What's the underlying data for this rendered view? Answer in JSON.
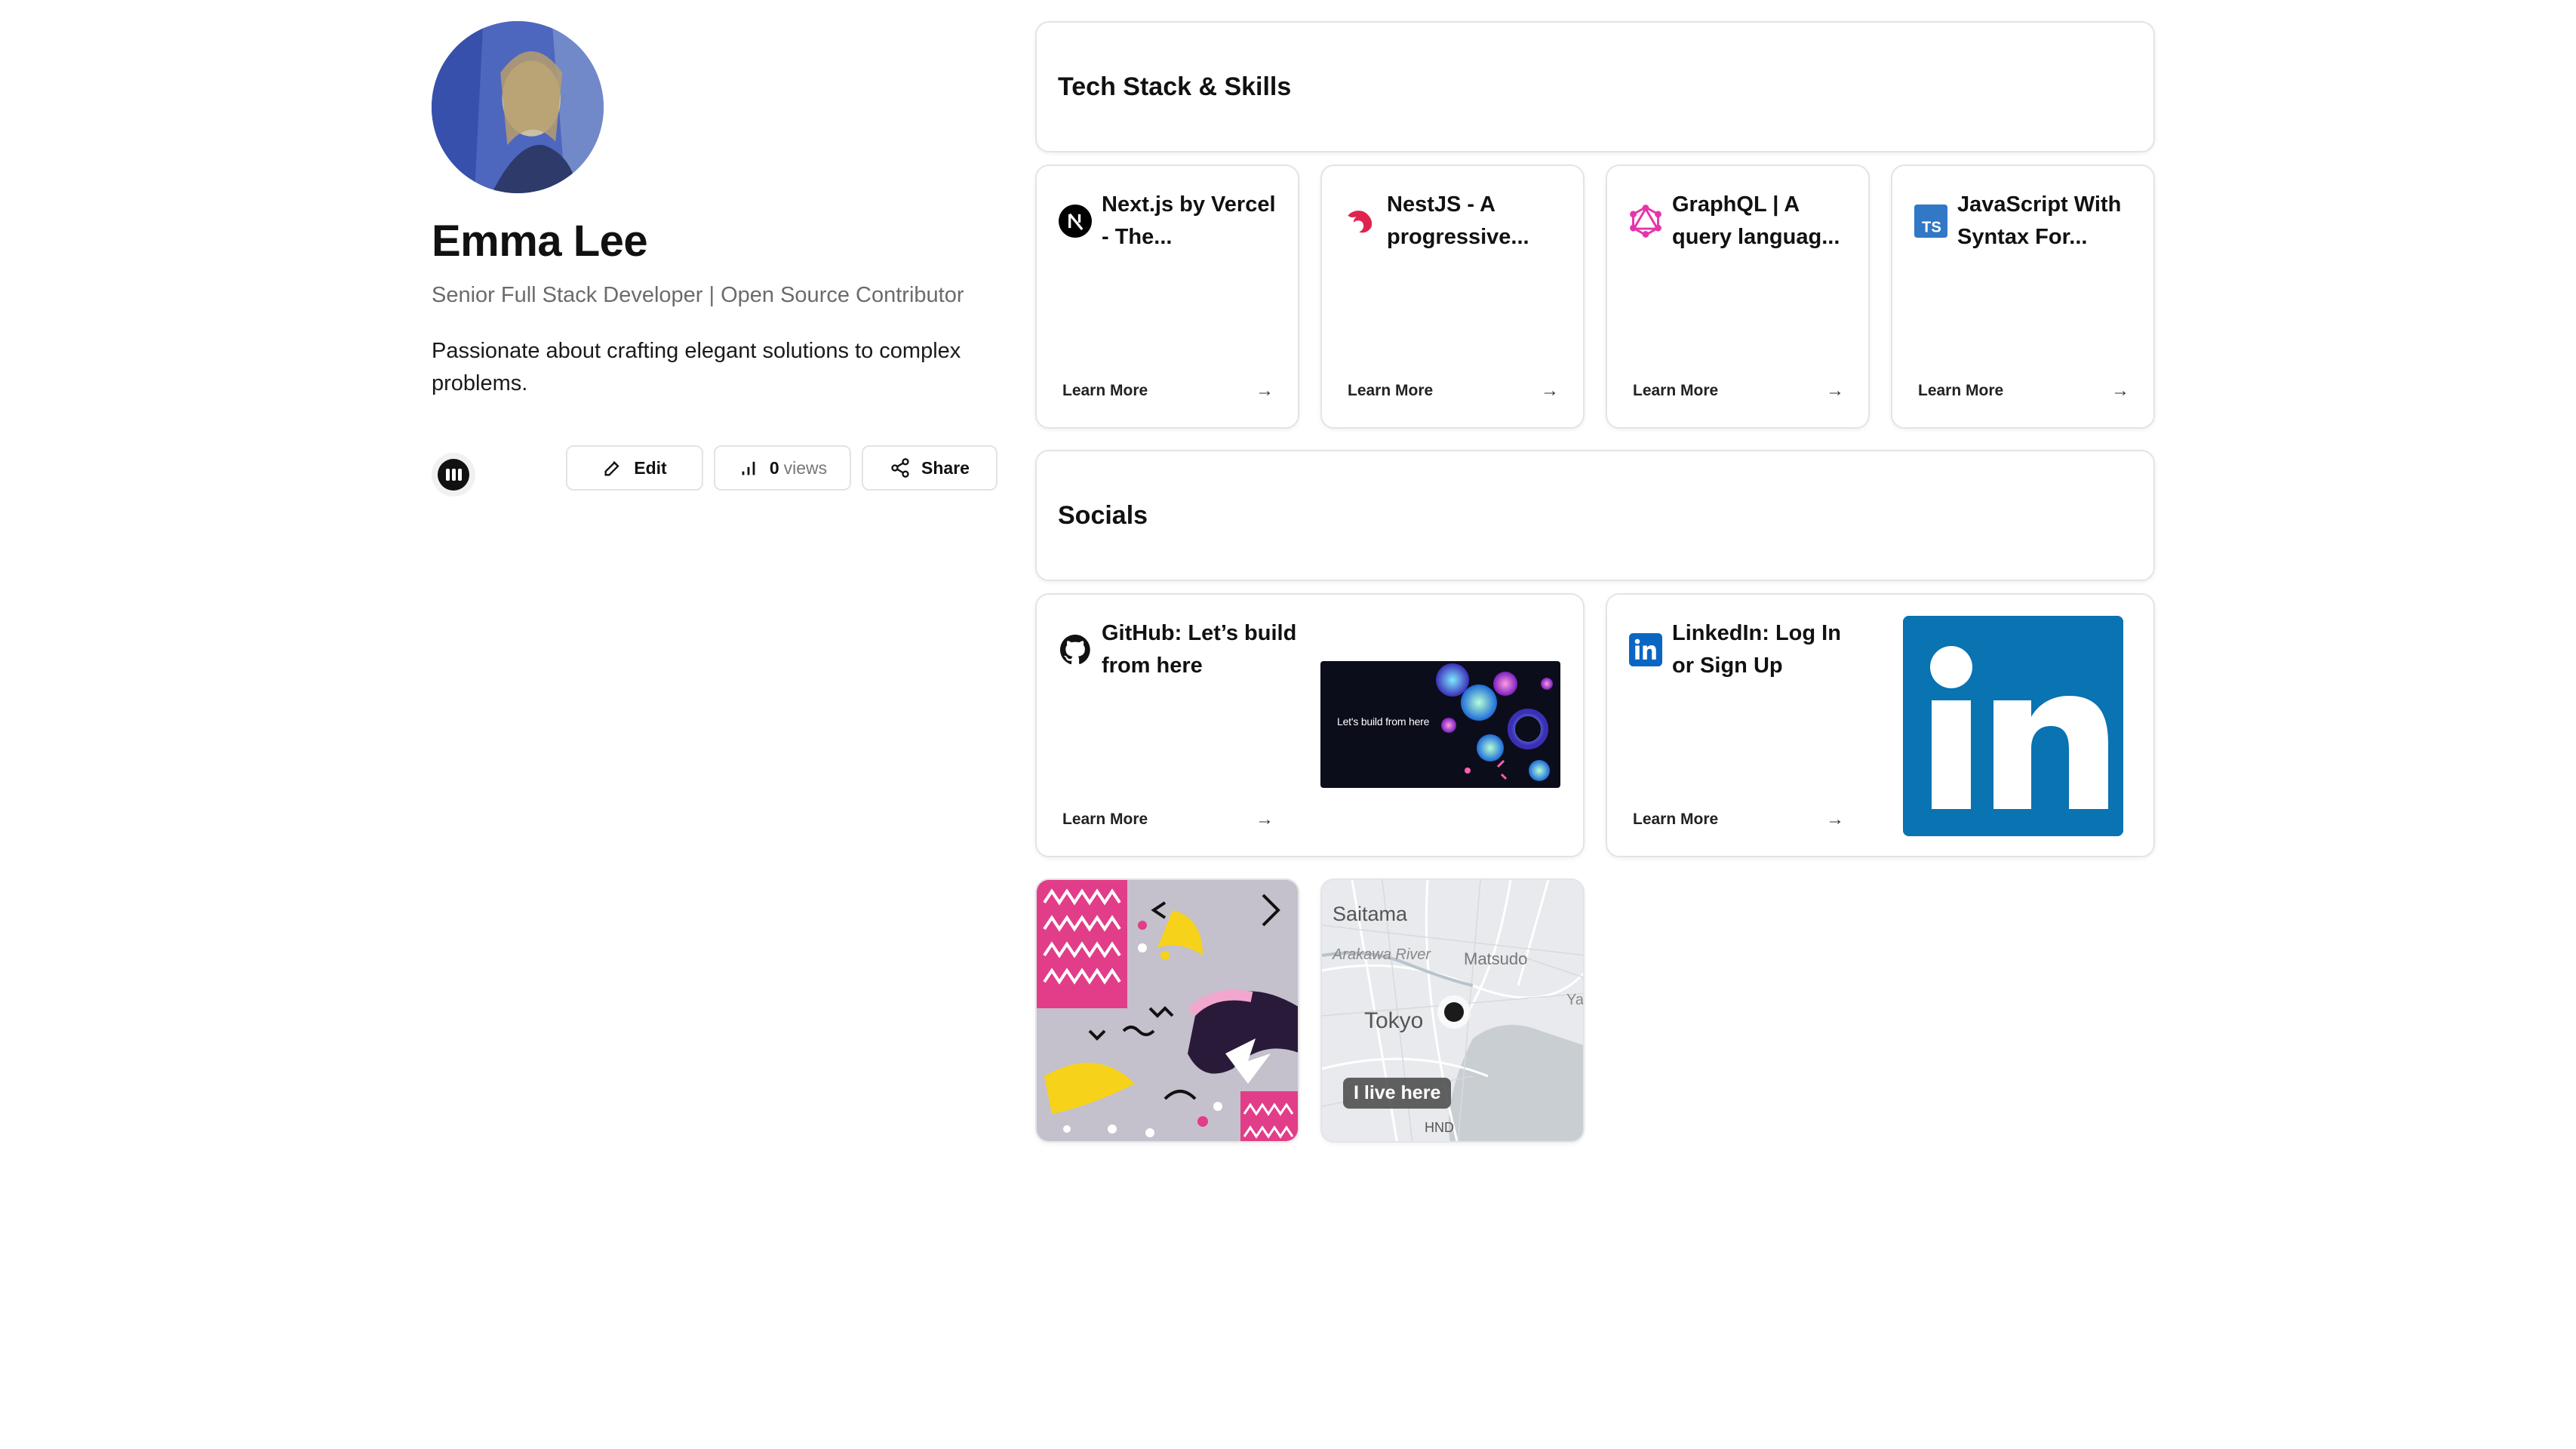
{
  "profile": {
    "name": "Emma Lee",
    "subtitle": "Senior Full Stack Developer | Open Source Contributor",
    "bio": "Passionate about crafting elegant solutions to complex problems."
  },
  "actions": {
    "edit_label": "Edit",
    "views_count": "0",
    "views_label": "views",
    "share_label": "Share"
  },
  "sections": {
    "tech": "Tech Stack & Skills",
    "socials": "Socials"
  },
  "tech_tiles": [
    {
      "title": "Next.js by Vercel - The...",
      "icon": "nextjs-icon",
      "cta": "Learn More"
    },
    {
      "title": "NestJS - A progressive...",
      "icon": "nestjs-icon",
      "cta": "Learn More"
    },
    {
      "title": "GraphQL | A query languag...",
      "icon": "graphql-icon",
      "cta": "Learn More"
    },
    {
      "title": "JavaScript With Syntax For...",
      "icon": "typescript-icon",
      "cta": "Learn More"
    }
  ],
  "social_tiles": [
    {
      "title": "GitHub: Let’s build from here",
      "icon": "github-icon",
      "cta": "Learn More",
      "thumb_text": "Let's build from here"
    },
    {
      "title": "LinkedIn: Log In or Sign Up",
      "icon": "linkedin-icon",
      "cta": "Learn More"
    }
  ],
  "map": {
    "labels": [
      "Saitama",
      "Arakawa River",
      "Matsudo",
      "Tokyo",
      "Ya",
      "HND"
    ],
    "pill": "I live here"
  },
  "colors": {
    "nest": "#e0234e",
    "graphql": "#e535ab",
    "ts": "#3178c6",
    "linkedin": "#0a66c2"
  }
}
